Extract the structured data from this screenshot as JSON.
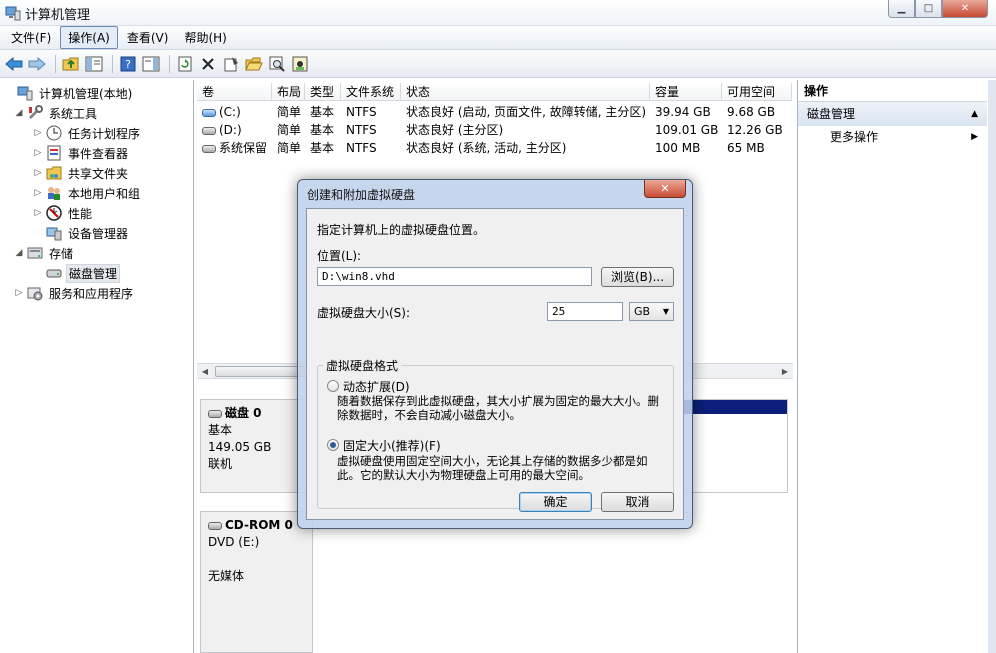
{
  "window": {
    "title": "计算机管理"
  },
  "menu": [
    "文件(F)",
    "操作(A)",
    "查看(V)",
    "帮助(H)"
  ],
  "tree": [
    {
      "label": "计算机管理(本地)",
      "level": 0,
      "expander": ""
    },
    {
      "label": "系统工具",
      "level": 1,
      "expander": "◢"
    },
    {
      "label": "任务计划程序",
      "level": 2,
      "expander": "▷"
    },
    {
      "label": "事件查看器",
      "level": 2,
      "expander": "▷"
    },
    {
      "label": "共享文件夹",
      "level": 2,
      "expander": "▷"
    },
    {
      "label": "本地用户和组",
      "level": 2,
      "expander": "▷"
    },
    {
      "label": "性能",
      "level": 2,
      "expander": "▷"
    },
    {
      "label": "设备管理器",
      "level": 2,
      "expander": ""
    },
    {
      "label": "存储",
      "level": 1,
      "expander": "◢"
    },
    {
      "label": "磁盘管理",
      "level": 2,
      "expander": ""
    },
    {
      "label": "服务和应用程序",
      "level": 1,
      "expander": "▷"
    }
  ],
  "volumes": {
    "columns": [
      "卷",
      "布局",
      "类型",
      "文件系统",
      "状态",
      "容量",
      "可用空间"
    ],
    "rows": [
      [
        "(C:)",
        "简单",
        "基本",
        "NTFS",
        "状态良好 (启动, 页面文件, 故障转储, 主分区)",
        "39.94 GB",
        "9.68 GB"
      ],
      [
        "(D:)",
        "简单",
        "基本",
        "NTFS",
        "状态良好 (主分区)",
        "109.01 GB",
        "12.26 GB"
      ],
      [
        "系统保留",
        "简单",
        "基本",
        "NTFS",
        "状态良好 (系统, 活动, 主分区)",
        "100 MB",
        "65 MB"
      ]
    ]
  },
  "disks": [
    {
      "name": "磁盘 0",
      "type": "基本",
      "size": "149.05 GB",
      "status": "联机"
    },
    {
      "name": "CD-ROM 0",
      "type": "DVD (E:)",
      "size": "",
      "status": "无媒体"
    }
  ],
  "actions": {
    "header": "操作",
    "section": "磁盘管理",
    "more": "更多操作"
  },
  "dialog": {
    "title": "创建和附加虚拟硬盘",
    "intro": "指定计算机上的虚拟硬盘位置。",
    "location_label": "位置(L):",
    "location_value": "D:\\win8.vhd",
    "browse": "浏览(B)...",
    "size_label": "虚拟硬盘大小(S):",
    "size_value": "25",
    "unit": "GB",
    "format_group": "虚拟硬盘格式",
    "dynamic_label": "动态扩展(D)",
    "dynamic_desc": "随着数据保存到此虚拟硬盘，其大小扩展为固定的最大大小。删除数据时，不会自动减小磁盘大小。",
    "fixed_label": "固定大小(推荐)(F)",
    "fixed_desc": "虚拟硬盘使用固定空间大小，无论其上存储的数据多少都是如此。它的默认大小为物理硬盘上可用的最大空间。",
    "selected_format": "fixed",
    "ok": "确定",
    "cancel": "取消"
  }
}
